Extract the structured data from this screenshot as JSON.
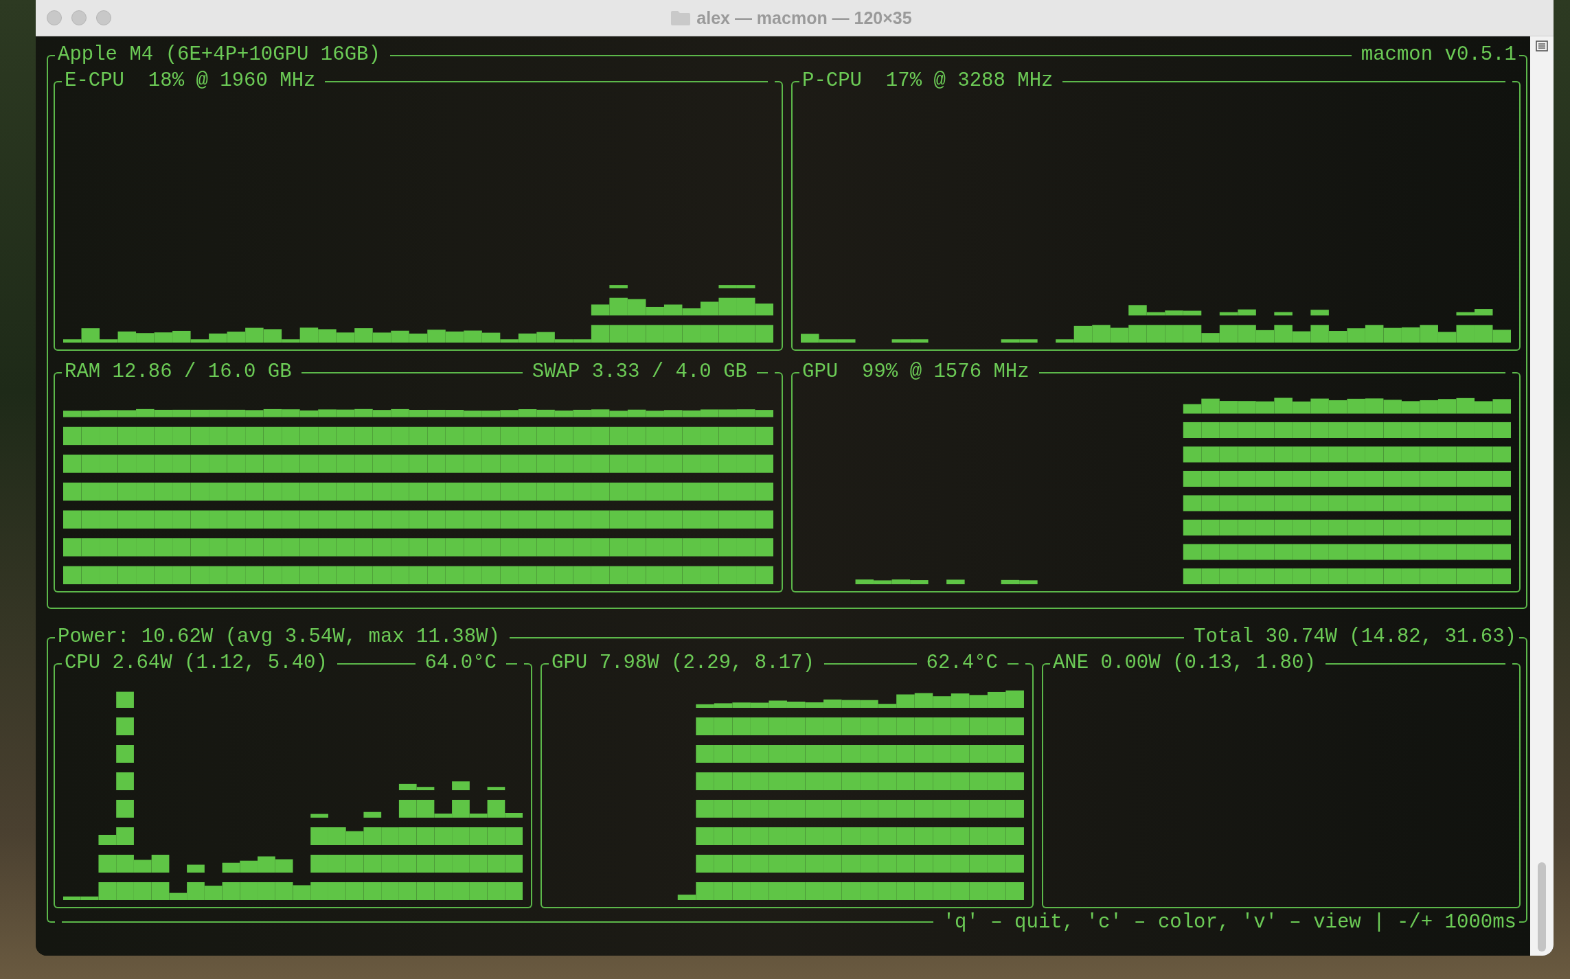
{
  "window": {
    "title": "alex — macmon — 120×35"
  },
  "header": {
    "title": "Apple M4 (6E+4P+10GPU 16GB)",
    "version": "macmon v0.5.1"
  },
  "panels": [
    {
      "title": "E-CPU  18% @ 1960 MHz"
    },
    {
      "title": "P-CPU  17% @ 3288 MHz"
    },
    {
      "title": "RAM 12.86 / 16.0 GB",
      "right": "SWAP 3.33 / 4.0 GB"
    },
    {
      "title": "GPU  99% @ 1576 MHz"
    }
  ],
  "power": {
    "title": "Power: 10.62W (avg 3.54W, max 11.38W)",
    "total": "Total 30.74W (14.82, 31.63)",
    "panels": [
      {
        "title": "CPU 2.64W (1.12, 5.40)",
        "right": "64.0°C"
      },
      {
        "title": "GPU 7.98W (2.29, 8.17)",
        "right": "62.4°C"
      },
      {
        "title": "ANE 0.00W (0.13, 1.80)"
      }
    ]
  },
  "footer": "'q' – quit, 'c' – color, 'v' – view | -/+ 1000ms"
}
